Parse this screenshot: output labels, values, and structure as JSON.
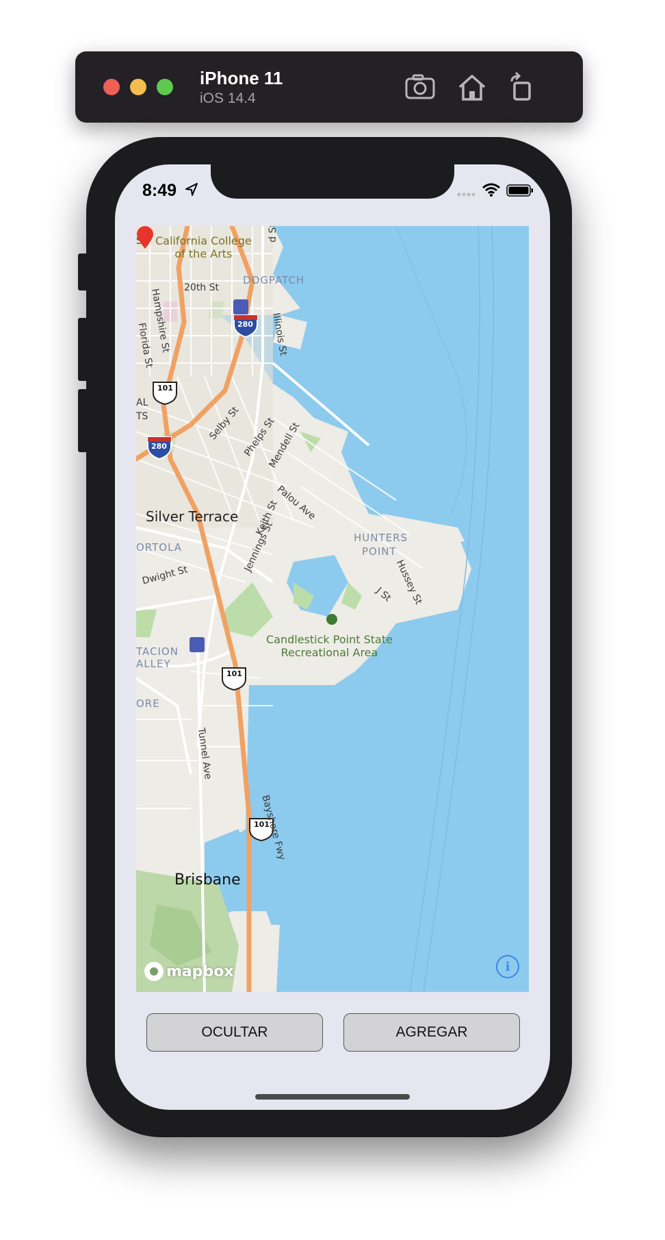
{
  "simulator": {
    "device_name": "iPhone 11",
    "os_version": "iOS 14.4",
    "icons": [
      "screenshot-icon",
      "home-icon",
      "rotate-icon"
    ]
  },
  "status_bar": {
    "time": "8:49",
    "icons": [
      "location-arrow-icon",
      "cellular-signal-icon",
      "wifi-icon",
      "battery-icon"
    ]
  },
  "map": {
    "labels": {
      "college_line1": "California College",
      "college_line2": "of the Arts",
      "dogpatch": "DOGPATCH",
      "twentieth_st": "20th St",
      "hampshire_st": "Hampshire St",
      "florida_st": "Florida St",
      "illinois_st": "Illinois St",
      "selby_st": "Selby St",
      "phelps_st": "Phelps St",
      "mendell_st": "Mendell St",
      "palou_ave": "Palou Ave",
      "keith_st": "Keith St",
      "jennings_st": "Jennings St",
      "silver_terrace": "Silver Terrace",
      "portola": "ORTOLA",
      "dwight_st": "Dwight St",
      "hunters": "HUNTERS",
      "point": "POINT",
      "hussey_st": "Hussey St",
      "j_st": "J St",
      "park_line1": "Candlestick Point State",
      "park_line2": "Recreational Area",
      "visitacion_line1": "TACION",
      "visitacion_line2": "ALLEY",
      "ore": "ORE",
      "tunnel_ave": "Tunnel Ave",
      "bayshore_fwy": "Bayshore Fwy",
      "brisbane": "Brisbane",
      "st_top_left": "St",
      "st_top_right": "d St",
      "al": "AL",
      "ts": "TS"
    },
    "shields": {
      "us101": "101",
      "i280": "280"
    },
    "attribution": "mapbox",
    "info_symbol": "i",
    "marker_color": "#e8352b",
    "water_color": "#8ccbee"
  },
  "buttons": {
    "hide_label": "OCULTAR",
    "add_label": "AGREGAR"
  }
}
